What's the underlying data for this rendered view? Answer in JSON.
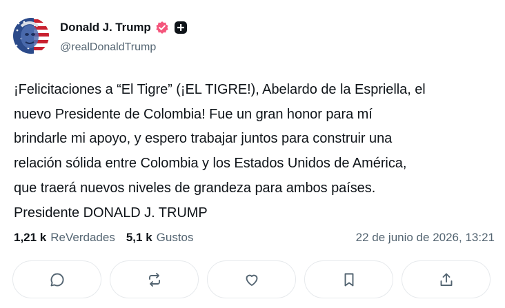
{
  "author": {
    "name": "Donald J. Trump",
    "handle": "@realDonaldTrump",
    "verified_icon": "verified-badge-icon",
    "plus_icon": "plus-badge-icon",
    "verified_color": "#f4567c"
  },
  "post": {
    "lines": [
      "¡Felicitaciones a “El Tigre” (¡EL TIGRE!), Abelardo de la Espriella, el",
      "nuevo Presidente de Colombia! Fue un gran honor para mí",
      "brindarle mi apoyo, y espero trabajar juntos para construir una",
      "relación sólida entre Colombia y los Estados Unidos de América,",
      "que traerá nuevos niveles de grandeza para ambos países.",
      "Presidente DONALD J. TRUMP"
    ]
  },
  "stats": {
    "reposts_count": "1,21 k",
    "reposts_label": "ReVerdades",
    "likes_count": "5,1 k",
    "likes_label": "Gustos",
    "date": "22 de junio de 2026, 13:21"
  },
  "actions": [
    "reply-icon",
    "repost-icon",
    "like-icon",
    "bookmark-icon",
    "share-icon"
  ]
}
